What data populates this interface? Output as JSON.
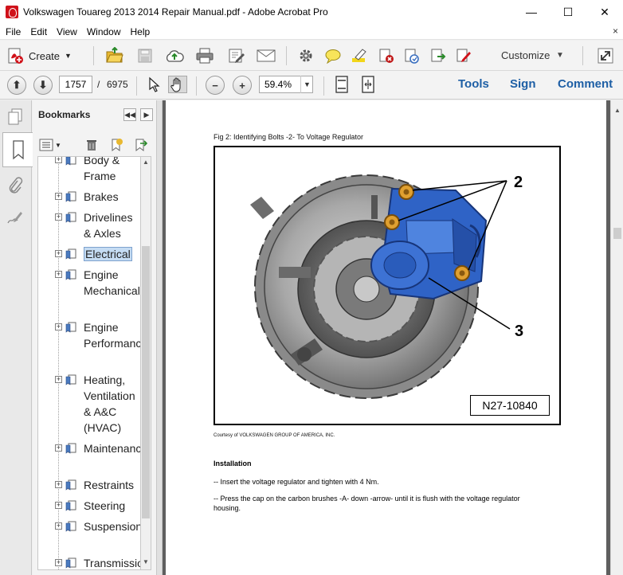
{
  "window": {
    "title": "Volkswagen Touareg 2013 2014 Repair Manual.pdf - Adobe Acrobat Pro",
    "minimize": "—",
    "maximize": "☐",
    "close": "✕"
  },
  "menu": {
    "items": [
      "File",
      "Edit",
      "View",
      "Window",
      "Help"
    ],
    "close": "×"
  },
  "toolbar": {
    "create_label": "Create",
    "customize_label": "Customize"
  },
  "navigation": {
    "current_page": "1757",
    "separator": "/",
    "total_pages": "6975",
    "zoom": "59.4%"
  },
  "panes": {
    "tools": "Tools",
    "sign": "Sign",
    "comment": "Comment"
  },
  "bookmarks": {
    "title": "Bookmarks",
    "items": [
      {
        "label": "Body & Frame",
        "selected": false
      },
      {
        "label": "Brakes",
        "selected": false
      },
      {
        "label": "Drivelines & Axles",
        "selected": false
      },
      {
        "label": "Electrical",
        "selected": true
      },
      {
        "label": "Engine Mechanical",
        "selected": false
      },
      {
        "label": "Engine Performance",
        "selected": false
      },
      {
        "label": "Heating, Ventilation & A&C (HVAC)",
        "selected": false
      },
      {
        "label": "Maintenance",
        "selected": false
      },
      {
        "label": "Restraints",
        "selected": false
      },
      {
        "label": "Steering",
        "selected": false
      },
      {
        "label": "Suspension",
        "selected": false
      },
      {
        "label": "Transmission",
        "selected": false
      }
    ]
  },
  "document": {
    "figure_caption": "Fig 2: Identifying Bolts -2- To Voltage Regulator",
    "figure_callouts": [
      "2",
      "3"
    ],
    "figure_code": "N27-10840",
    "courtesy": "Courtesy of VOLKSWAGEN GROUP OF AMERICA, INC.",
    "section_heading": "Installation",
    "steps": [
      "-- Insert the voltage regulator and tighten with 4 Nm.",
      "-- Press the cap on the carbon brushes -A- down -arrow- until it is flush with the voltage regulator housing."
    ]
  },
  "colors": {
    "accent_link": "#1e5fa5",
    "selection": "#c5dcf3",
    "regulator_blue": "#2f63c6",
    "bolt_gold": "#e0a030"
  }
}
